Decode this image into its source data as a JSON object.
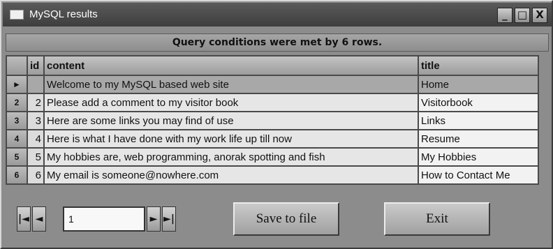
{
  "window": {
    "title": "MySQL results",
    "controls": {
      "minimize": "_",
      "maximize": "□",
      "close": "X"
    }
  },
  "caption": "Query conditions were met by 6 rows.",
  "grid": {
    "columns": [
      "id",
      "content",
      "title"
    ],
    "current_row_marker": "►",
    "rows": [
      {
        "row_header": "",
        "id": "",
        "content": "Welcome to my MySQL based web site",
        "title": "Home"
      },
      {
        "row_header": "2",
        "id": "2",
        "content": "Please add a comment to my visitor book",
        "title": "Visitorbook"
      },
      {
        "row_header": "3",
        "id": "3",
        "content": "Here are some links you may find of use",
        "title": "Links"
      },
      {
        "row_header": "4",
        "id": "4",
        "content": "Here is what I have done with my work life up till now",
        "title": "Resume"
      },
      {
        "row_header": "5",
        "id": "5",
        "content": "My hobbies are, web programming, anorak spotting and fish",
        "title": "My Hobbies"
      },
      {
        "row_header": "6",
        "id": "6",
        "content": "My email is someone@nowhere.com",
        "title": "How to Contact Me"
      }
    ]
  },
  "navigator": {
    "first": "|◄",
    "prev": "◄",
    "record_value": "1",
    "next": "►",
    "last": "►|"
  },
  "buttons": {
    "save": "Save to file",
    "exit": "Exit"
  }
}
